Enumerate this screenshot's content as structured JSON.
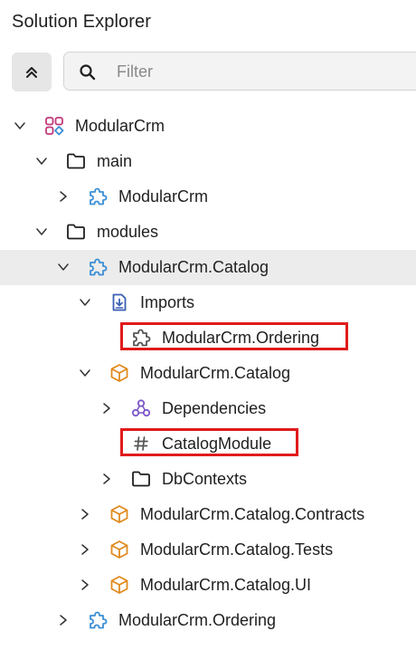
{
  "panel": {
    "title": "Solution Explorer"
  },
  "toolbar": {
    "collapse_icon": "double-chevron-up-icon",
    "search": {
      "placeholder": "Filter",
      "value": "",
      "icon": "search-icon"
    }
  },
  "tree": {
    "nodes": [
      {
        "label": "ModularCrm",
        "icon": "solution-icon",
        "expanded": true
      },
      {
        "label": "main",
        "icon": "folder-icon",
        "expanded": true
      },
      {
        "label": "ModularCrm",
        "icon": "module-puzzle-icon",
        "expanded": false
      },
      {
        "label": "modules",
        "icon": "folder-icon",
        "expanded": true
      },
      {
        "label": "ModularCrm.Catalog",
        "icon": "module-puzzle-icon",
        "expanded": true,
        "selected": true
      },
      {
        "label": "Imports",
        "icon": "imports-icon",
        "expanded": true
      },
      {
        "label": "ModularCrm.Ordering",
        "icon": "module-puzzle-outline-icon",
        "highlighted": true
      },
      {
        "label": "ModularCrm.Catalog",
        "icon": "package-icon",
        "expanded": true
      },
      {
        "label": "Dependencies",
        "icon": "dependencies-icon",
        "expanded": false
      },
      {
        "label": "CatalogModule",
        "icon": "hash-icon",
        "highlighted": true
      },
      {
        "label": "DbContexts",
        "icon": "folder-icon",
        "expanded": false
      },
      {
        "label": "ModularCrm.Catalog.Contracts",
        "icon": "package-icon",
        "expanded": false
      },
      {
        "label": "ModularCrm.Catalog.Tests",
        "icon": "package-icon",
        "expanded": false
      },
      {
        "label": "ModularCrm.Catalog.UI",
        "icon": "package-icon",
        "expanded": false
      },
      {
        "label": "ModularCrm.Ordering",
        "icon": "module-puzzle-icon",
        "expanded": false
      }
    ]
  },
  "colors": {
    "highlight_border": "#e01b1b",
    "selected_row": "#ececec",
    "puzzle_blue": "#3b8fd6",
    "package_orange": "#e08a1e",
    "solution_pink": "#c2387a",
    "dependencies_purple": "#7b55c9",
    "imports_blue": "#3a5fb5"
  }
}
